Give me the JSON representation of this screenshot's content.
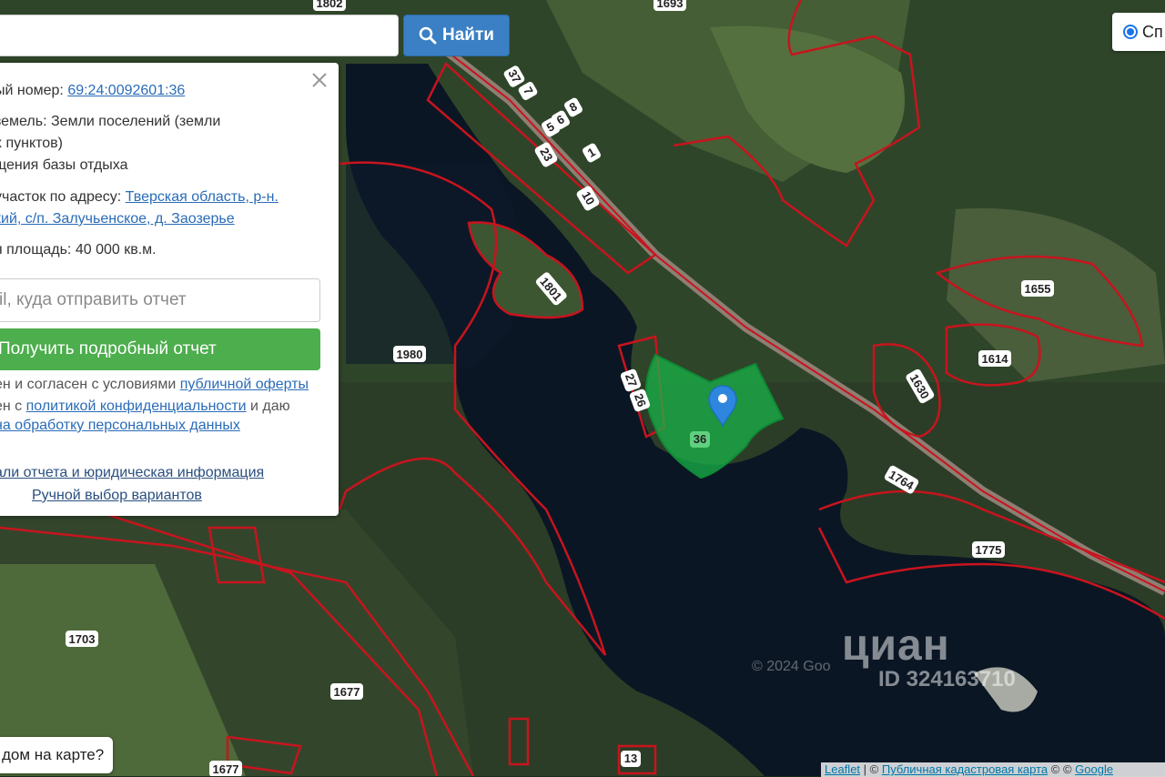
{
  "search": {
    "value": "",
    "button_label": "Найти"
  },
  "layer_toggle": {
    "label": "Сп"
  },
  "info_panel": {
    "cadastral_label": "ый номер:",
    "cadastral_number": "69:24:0092601:36",
    "land_label": "земель:",
    "land_value_1": "Земли поселений (земли",
    "land_value_2": "х пунктов)",
    "land_value_3": "щения базы отдыха",
    "address_label": "участок по адресу:",
    "address_1": "Тверская область, р-н.",
    "address_2": "кий, с/п. Залучьенское, д. Заозерье",
    "area_label": "я площадь:",
    "area_value": "40 000 кв.м.",
    "email_placeholder": "il, куда отправить отчет",
    "report_button": "Получить подробный отчет",
    "terms_1a": "ен и согласен с условиями ",
    "terms_1b": "публичной оферты",
    "terms_2a": "ен с ",
    "terms_2b": "политикой конфиденциальности",
    "terms_2c": " и даю",
    "terms_3": "на обработку персональных данных",
    "details_link": "али отчета и юридическая информация",
    "manual_link": "Ручной выбор вариантов"
  },
  "bottom_button": {
    "label": "дом на карте?"
  },
  "attribution": {
    "leaflet": "Leaflet",
    "sep1": " | © ",
    "cadastral": "Публичная кадастровая карта",
    "sep2": " © © ",
    "google": "Google"
  },
  "watermark": {
    "logo": "циан",
    "id": "ID 324163710",
    "copyright": "© 2024 Goo"
  },
  "map": {
    "selected_parcel": "36",
    "parcel_labels": [
      "1802",
      "1693",
      "37",
      "7",
      "6",
      "8",
      "5",
      "1",
      "23",
      "10",
      "1801",
      "1980",
      "27",
      "26",
      "1655",
      "1614",
      "1630",
      "1764",
      "1775",
      "1703",
      "1677",
      "1677",
      "13"
    ],
    "colors": {
      "parcel_border": "#c8141e",
      "selected_fill": "#19b34a",
      "marker": "#2e86de",
      "water": "#0b1624"
    }
  }
}
